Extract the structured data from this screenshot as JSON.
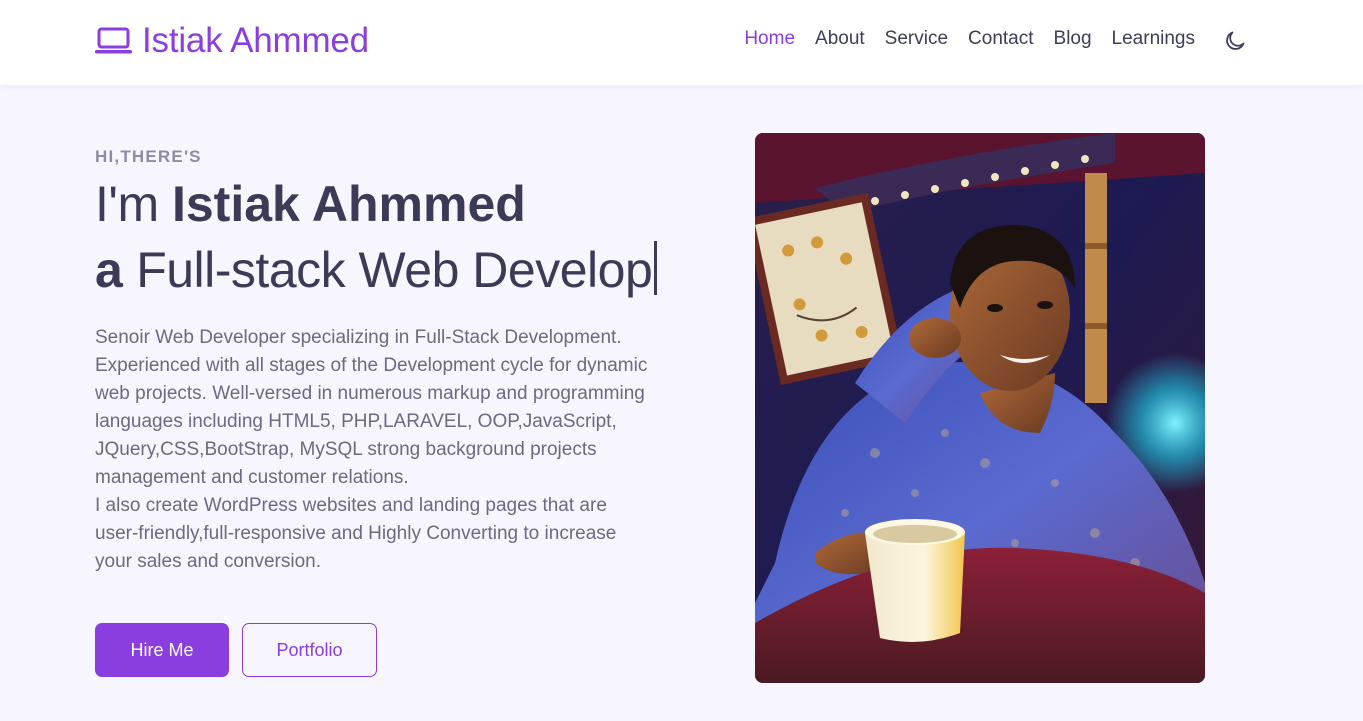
{
  "brand": {
    "name": "Istiak Ahmmed",
    "icon": "laptop-icon",
    "color": "#8a3ee0"
  },
  "nav": {
    "items": [
      {
        "label": "Home",
        "active": true
      },
      {
        "label": "About"
      },
      {
        "label": "Service"
      },
      {
        "label": "Contact"
      },
      {
        "label": "Blog"
      },
      {
        "label": "Learnings"
      }
    ],
    "theme_toggle_icon": "moon-icon"
  },
  "hero": {
    "eyebrow": "HI,THERE'S",
    "line1_prefix": "I'm ",
    "line1_name": "Istiak Ahmmed",
    "line2_prefix": "a",
    "line2_text": " Full-stack Web Develop",
    "bio_paragraph1": "Senoir Web Developer specializing in Full-Stack Development. Experienced with all stages of the Development cycle for dynamic web projects. Well-versed in numerous markup and programming languages including HTML5, PHP,LARAVEL, OOP,JavaScript, JQuery,CSS,BootStrap, MySQL strong background projects management and customer relations.",
    "bio_paragraph2": "I also create WordPress websites and landing pages that are user-friendly,full-responsive and Highly Converting to increase your sales and conversion.",
    "buttons": {
      "hire_label": "Hire Me",
      "portfolio_label": "Portfolio"
    }
  },
  "colors": {
    "accent": "#8a3ee0",
    "page_background": "#f7f5fd",
    "heading": "#3b3a57",
    "body_text": "#6c6a82"
  }
}
